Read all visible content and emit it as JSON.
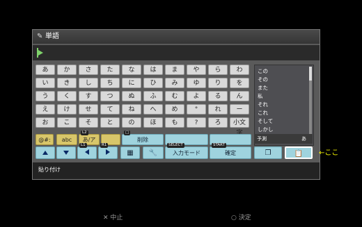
{
  "window": {
    "title": "単語"
  },
  "keyboard_rows": [
    [
      "あ",
      "か",
      "さ",
      "た",
      "な",
      "は",
      "ま",
      "や",
      "ら",
      "わ"
    ],
    [
      "い",
      "き",
      "し",
      "ち",
      "に",
      "ひ",
      "み",
      "ゆ",
      "り",
      "を"
    ],
    [
      "う",
      "く",
      "す",
      "つ",
      "ぬ",
      "ふ",
      "む",
      "よ",
      "る",
      "ん"
    ],
    [
      "え",
      "け",
      "せ",
      "て",
      "ね",
      "へ",
      "め",
      "°",
      "れ",
      "ー"
    ],
    [
      "お",
      "こ",
      "そ",
      "と",
      "の",
      "ほ",
      "も",
      "?",
      "ろ",
      "小文字"
    ]
  ],
  "predictions": [
    "この",
    "その",
    "また",
    "私",
    "それ",
    "これ",
    "そして",
    "しかし"
  ],
  "predict_bar": {
    "label": "予測",
    "mode": "あ"
  },
  "row4": {
    "symbols": "@#:",
    "abc": "abc",
    "kana": "あ/ア",
    "kana_badge": "L2",
    "delete": "削除",
    "delete_badge": "□"
  },
  "row5": {
    "l1_badge": "L1",
    "r1_badge": "R1",
    "select_badge": "SELECT",
    "input_mode": "入力モード",
    "start_badge": "START",
    "confirm": "確定"
  },
  "bottom": {
    "label": "貼り付け"
  },
  "footer": {
    "cancel": "✕ 中止",
    "decide": "○ 決定"
  },
  "annotation": "←ここ",
  "colors": {
    "key_cyan": "#9fd3de",
    "key_yellow": "#d8c66a",
    "annotation": "#ffff00"
  }
}
